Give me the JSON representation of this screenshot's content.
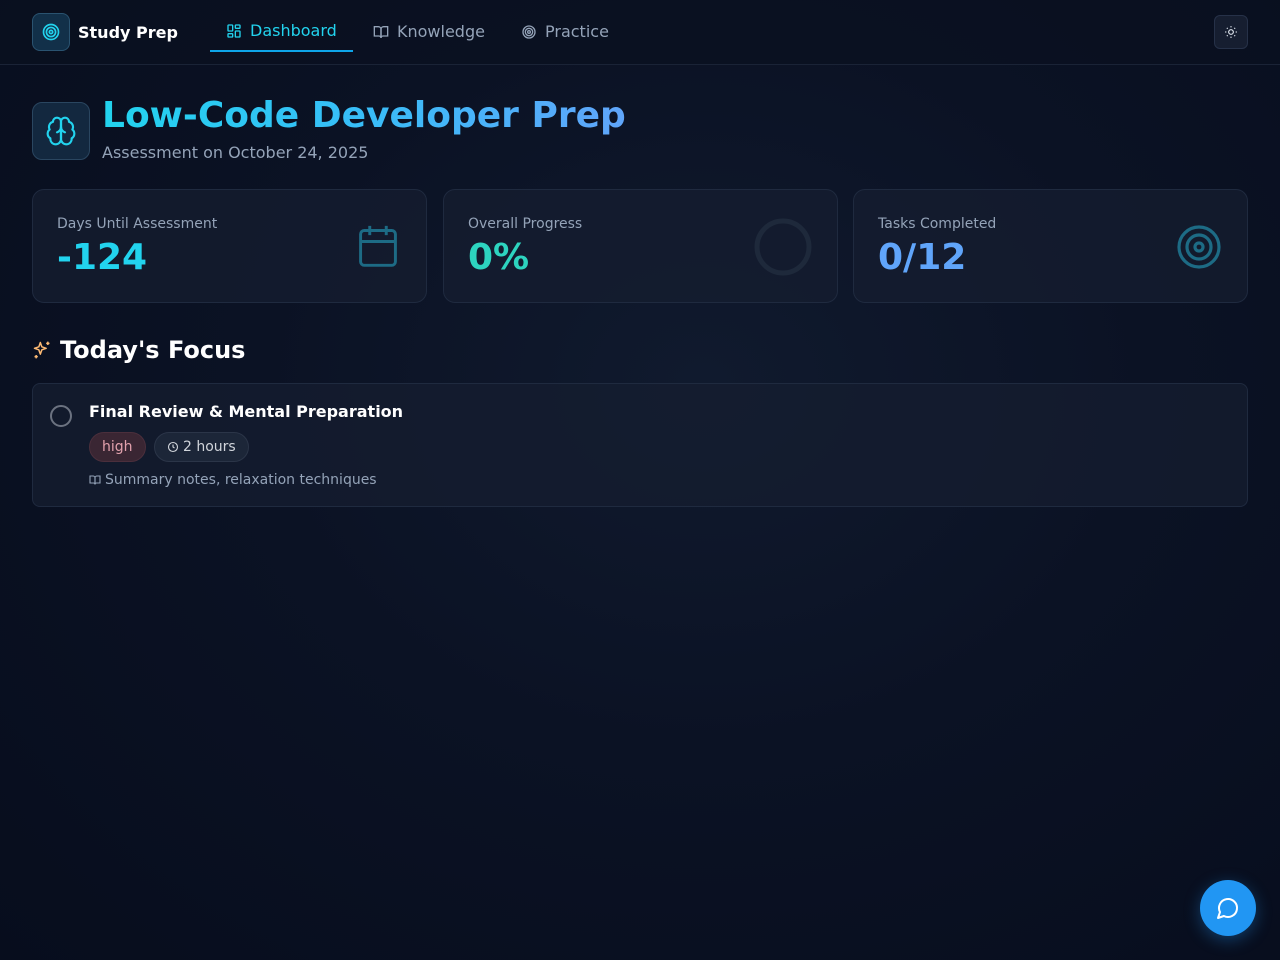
{
  "app": {
    "name": "Study Prep",
    "logo_icon": "target-icon"
  },
  "nav": {
    "tabs": [
      {
        "label": "Dashboard",
        "icon": "dashboard-grid-icon",
        "active": true
      },
      {
        "label": "Knowledge",
        "icon": "book-open-icon",
        "active": false
      },
      {
        "label": "Practice",
        "icon": "target-icon",
        "active": false
      }
    ],
    "theme_toggle_icon": "sun-icon"
  },
  "header": {
    "icon": "brain-icon",
    "title": "Low-Code Developer Prep",
    "subtitle": "Assessment on October 24, 2025"
  },
  "stats": [
    {
      "label": "Days Until Assessment",
      "value": "-124",
      "icon": "calendar-icon",
      "color": "#22d3ee"
    },
    {
      "label": "Overall Progress",
      "value": "0%",
      "icon": "progress-ring-icon",
      "color": "#2dd4bf",
      "progress": 0
    },
    {
      "label": "Tasks Completed",
      "value": "0/12",
      "icon": "target-icon",
      "color": "#60a5fa"
    }
  ],
  "focus": {
    "title": "Today's Focus",
    "icon": "sparkles-icon",
    "tasks": [
      {
        "title": "Final Review & Mental Preparation",
        "priority": "high",
        "duration": "2 hours",
        "resources": "Summary notes, relaxation techniques",
        "completed": false
      }
    ]
  },
  "chat": {
    "icon": "chat-bubble-icon"
  },
  "colors": {
    "accent": "#22d3ee",
    "primary_button": "#2196f3",
    "background": "#0b1224"
  }
}
